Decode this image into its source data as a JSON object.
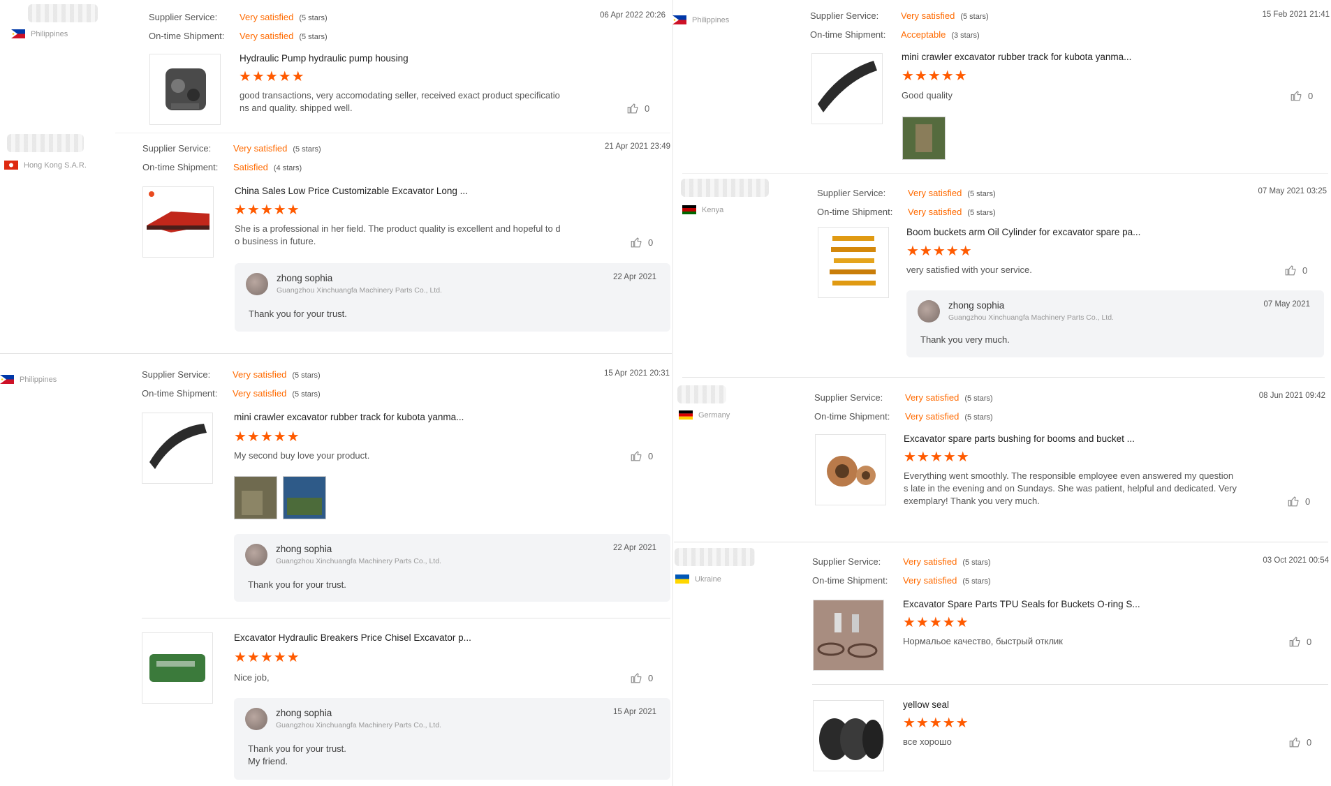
{
  "labels": {
    "service": "Supplier Service:",
    "shipment": "On-time Shipment:"
  },
  "star_glyphs": "★★★★★",
  "colors": {
    "accent": "#ff6a00",
    "star": "#ff5a00"
  },
  "left": {
    "r1": {
      "country": "Philippines",
      "service": "Very satisfied",
      "service_stars": "(5 stars)",
      "shipment": "Very satisfied",
      "shipment_stars": "(5 stars)",
      "date": "06 Apr 2022 20:26",
      "title": "Hydraulic Pump hydraulic pump housing",
      "rating": 5,
      "comment_l1": "good transactions, very accomodating seller,  received exact product specificatio",
      "comment_l2": "ns and quality. shipped well.",
      "likes": "0"
    },
    "r2": {
      "country": "Hong Kong S.A.R.",
      "service": "Very satisfied",
      "service_stars": "(5 stars)",
      "shipment": "Satisfied",
      "shipment_stars": "(4 stars)",
      "date": "21 Apr 2021 23:49",
      "title": "China Sales Low Price Customizable Excavator Long ...",
      "rating": 5,
      "comment_l1": "She is a professional in her field. The product quality is excellent and hopeful to d",
      "comment_l2": "o business in future.",
      "likes": "0",
      "reply": {
        "name": "zhong sophia",
        "company": "Guangzhou Xinchuangfa Machinery Parts Co., Ltd.",
        "date": "22 Apr 2021",
        "text": "Thank you for your trust."
      }
    },
    "r3": {
      "country": "Philippines",
      "service": "Very satisfied",
      "service_stars": "(5 stars)",
      "shipment": "Very satisfied",
      "shipment_stars": "(5 stars)",
      "date": "15 Apr 2021 20:31",
      "title": "mini crawler excavator rubber track for kubota yanma...",
      "rating": 5,
      "comment": "My second buy love your product.",
      "likes": "0",
      "reply": {
        "name": "zhong sophia",
        "company": "Guangzhou Xinchuangfa Machinery Parts Co., Ltd.",
        "date": "22 Apr 2021",
        "text": "Thank you for your trust."
      }
    },
    "r4": {
      "title": "Excavator Hydraulic Breakers Price Chisel Excavator p...",
      "rating": 5,
      "comment": "Nice job,",
      "likes": "0",
      "reply": {
        "name": "zhong sophia",
        "company": "Guangzhou Xinchuangfa Machinery Parts Co., Ltd.",
        "date": "15 Apr 2021",
        "text_l1": "Thank you for your trust.",
        "text_l2": "My friend."
      }
    }
  },
  "right": {
    "r1": {
      "country": "Philippines",
      "service": "Very satisfied",
      "service_stars": "(5 stars)",
      "shipment": "Acceptable",
      "shipment_stars": "(3 stars)",
      "date": "15 Feb 2021 21:41",
      "title": "mini crawler excavator rubber track for kubota yanma...",
      "rating": 5,
      "comment": "Good quality",
      "likes": "0"
    },
    "r2": {
      "country": "Kenya",
      "service": "Very satisfied",
      "service_stars": "(5 stars)",
      "shipment": "Very satisfied",
      "shipment_stars": "(5 stars)",
      "date": "07 May 2021 03:25",
      "title": "Boom buckets arm Oil Cylinder for excavator spare pa...",
      "rating": 5,
      "comment": "very satisfied with your service.",
      "likes": "0",
      "reply": {
        "name": "zhong sophia",
        "company": "Guangzhou Xinchuangfa Machinery Parts Co., Ltd.",
        "date": "07 May 2021",
        "text": "Thank you very much."
      }
    },
    "r3": {
      "country": "Germany",
      "service": "Very satisfied",
      "service_stars": "(5 stars)",
      "shipment": "Very satisfied",
      "shipment_stars": "(5 stars)",
      "date": "08 Jun 2021 09:42",
      "title": "Excavator spare parts bushing for booms and bucket ...",
      "rating": 5,
      "comment_l1": "Everything went smoothly. The responsible employee even answered my question",
      "comment_l2": "s late in the evening and on Sundays. She was patient, helpful and dedicated. Very",
      "comment_l3": "exemplary! Thank you very much.",
      "likes": "0"
    },
    "r4": {
      "country": "Ukraine",
      "service": "Very satisfied",
      "service_stars": "(5 stars)",
      "shipment": "Very satisfied",
      "shipment_stars": "(5 stars)",
      "date": "03 Oct 2021 00:54",
      "title": "Excavator Spare Parts TPU Seals for Buckets O-ring S...",
      "rating": 5,
      "comment": "Нормальое качество, быстрый отклик",
      "likes": "0"
    },
    "r5": {
      "title": "yellow seal",
      "rating": 5,
      "comment": "все хорошо",
      "likes": "0"
    }
  }
}
